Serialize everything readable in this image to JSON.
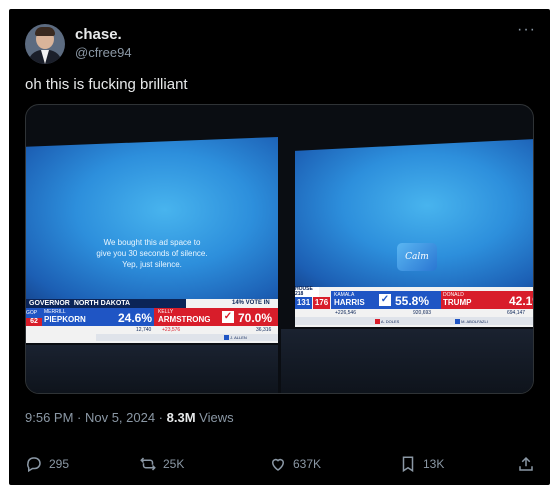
{
  "author": {
    "display_name": "chase.",
    "handle": "@cfree94"
  },
  "tweet_text": "oh this is fucking brilliant",
  "media": {
    "left_photo": {
      "ad_text_lines": [
        "We bought this ad space to",
        "give you 30 seconds of silence.",
        "Yep, just silence."
      ],
      "race_label": "GOVERNOR",
      "state": "NORTH DAKOTA",
      "vote_in": "14% VOTE IN",
      "dem": {
        "first": "MERRILL",
        "last": "PIEPKORN",
        "pct": "24.6%",
        "votes": "12,740"
      },
      "rep": {
        "first": "KELLY",
        "last": "ARMSTRONG",
        "pct": "70.0%",
        "votes": "36,316",
        "margin": "+23,576"
      },
      "gop_tag": "GOP",
      "left_badge": "62",
      "right_total": "36,316",
      "ticker_right": "J. ALLEN"
    },
    "right_photo": {
      "calm_logo": "Calm",
      "house_label": "HOUSE",
      "house_need": "218",
      "dem_seats": "131",
      "rep_seats": "176",
      "dem": {
        "first": "KAMALA",
        "last": "HARRIS",
        "pct": "55.8%",
        "votes": "920,693",
        "margin": "+226,546"
      },
      "rep": {
        "first": "DONALD",
        "last": "TRUMP",
        "pct": "42.1%",
        "votes": "694,147"
      },
      "ticker_1": "A. DOLES",
      "ticker_2": "M. ABOLFAZLI"
    }
  },
  "timestamp": "9:56 PM · Nov 5, 2024 · ",
  "views_count": "8.3M",
  "views_label": " Views",
  "actions": {
    "replies": "295",
    "reposts": "25K",
    "likes": "637K",
    "bookmarks": "13K"
  },
  "colors": {
    "background": "#000000",
    "text_primary": "#e7e9ea",
    "text_secondary": "#8b98a5",
    "dem_blue": "#1f55c4",
    "rep_red": "#d81d2a"
  }
}
